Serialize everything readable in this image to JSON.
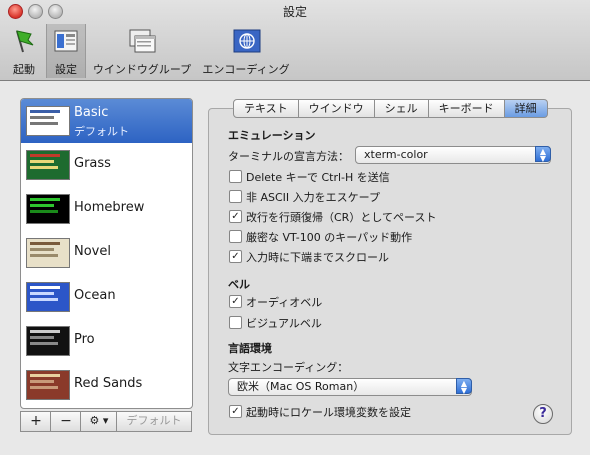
{
  "window": {
    "title": "設定"
  },
  "toolbar": {
    "items": [
      {
        "label": "起動",
        "icon": "flag-icon"
      },
      {
        "label": "設定",
        "icon": "settings-window-icon"
      },
      {
        "label": "ウインドウグループ",
        "icon": "window-group-icon"
      },
      {
        "label": "エンコーディング",
        "icon": "encoding-globe-icon"
      }
    ]
  },
  "profiles": {
    "items": [
      {
        "name": "Basic",
        "sub": "デフォルト",
        "thumb_bg": "#ffffff",
        "thumb_accent": "#3a5ea8"
      },
      {
        "name": "Grass",
        "thumb_bg": "#1e6b2f",
        "thumb_accent": "#c23a2a"
      },
      {
        "name": "Homebrew",
        "thumb_bg": "#000000",
        "thumb_accent": "#2ec52e"
      },
      {
        "name": "Novel",
        "thumb_bg": "#e8e0c8",
        "thumb_accent": "#7a5a3a"
      },
      {
        "name": "Ocean",
        "thumb_bg": "#2c56c8",
        "thumb_accent": "#ffffff"
      },
      {
        "name": "Pro",
        "thumb_bg": "#111111",
        "thumb_accent": "#cccccc"
      },
      {
        "name": "Red Sands",
        "thumb_bg": "#8a3a2a",
        "thumb_accent": "#e8d0a0"
      }
    ],
    "add_label": "+",
    "remove_label": "−",
    "gear_label": "⚙ ▾",
    "default_label": "デフォルト"
  },
  "tabs": [
    "テキスト",
    "ウインドウ",
    "シェル",
    "キーボード",
    "詳細"
  ],
  "emulation": {
    "heading": "エミュレーション",
    "declare_label": "ターミナルの宣言方法：",
    "declare_value": "xterm-color",
    "options": [
      {
        "label": "Delete キーで Ctrl-H を送信",
        "checked": false
      },
      {
        "label": "非 ASCII 入力をエスケープ",
        "checked": false
      },
      {
        "label": "改行を行頭復帰（CR）としてペースト",
        "checked": true
      },
      {
        "label": "厳密な VT-100 のキーパッド動作",
        "checked": false
      },
      {
        "label": "入力時に下端までスクロール",
        "checked": true
      }
    ]
  },
  "bell": {
    "heading": "ベル",
    "options": [
      {
        "label": "オーディオベル",
        "checked": true
      },
      {
        "label": "ビジュアルベル",
        "checked": false
      }
    ]
  },
  "language": {
    "heading": "言語環境",
    "encoding_label": "文字エンコーディング：",
    "encoding_value": "欧米（Mac OS Roman）",
    "locale_label": "起動時にロケール環境変数を設定",
    "locale_checked": true
  },
  "help_label": "?"
}
